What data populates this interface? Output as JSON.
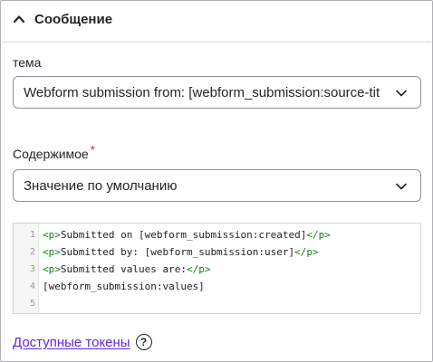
{
  "section": {
    "title": "Сообщение",
    "icon": "chevron-up-icon"
  },
  "subject": {
    "label": "тема",
    "value": "Webform submission from: [webform_submission:source-tit"
  },
  "body": {
    "label": "Содержимое",
    "required_mark": "*",
    "value": "Значение по умолчанию"
  },
  "editor": {
    "lines": [
      {
        "num": "1",
        "open": "<p>",
        "text": "Submitted on [webform_submission:created]",
        "close": "</p>"
      },
      {
        "num": "2",
        "open": "<p>",
        "text": "Submitted by: [webform_submission:user]",
        "close": "</p>"
      },
      {
        "num": "3",
        "open": "<p>",
        "text": "Submitted values are:",
        "close": "</p>"
      },
      {
        "num": "4",
        "open": "",
        "text": "[webform_submission:values]",
        "close": ""
      },
      {
        "num": "5",
        "open": "",
        "text": "",
        "close": ""
      }
    ]
  },
  "tokens": {
    "link": "Доступные токены",
    "help": "?"
  },
  "colors": {
    "link": "#5a2bd8",
    "tag": "#1a7d1a",
    "required": "#dc2323",
    "border": "#8e929c"
  }
}
